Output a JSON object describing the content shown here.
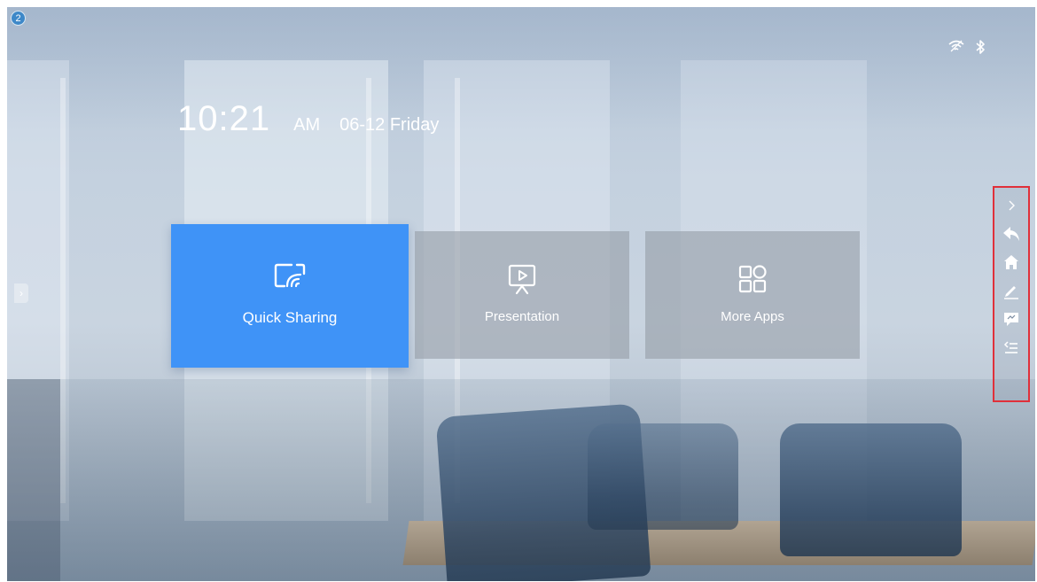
{
  "badge": {
    "count": "2"
  },
  "status": {
    "icons": [
      "wifi-icon",
      "bluetooth-icon"
    ]
  },
  "clock": {
    "time": "10:21",
    "ampm": "AM",
    "date": "06-12 Friday"
  },
  "tiles": [
    {
      "label": "Quick Sharing",
      "icon": "screen-cast-icon",
      "color": "#3f93f7"
    },
    {
      "label": "Presentation",
      "icon": "presentation-icon"
    },
    {
      "label": "More Apps",
      "icon": "apps-grid-icon"
    }
  ],
  "left_tab": {
    "glyph": "›"
  },
  "toolbar": {
    "highlight_color": "#e0303a",
    "items": [
      "collapse-chevron-icon",
      "back-icon",
      "home-icon",
      "pen-icon",
      "comment-icon",
      "menu-list-icon"
    ]
  }
}
